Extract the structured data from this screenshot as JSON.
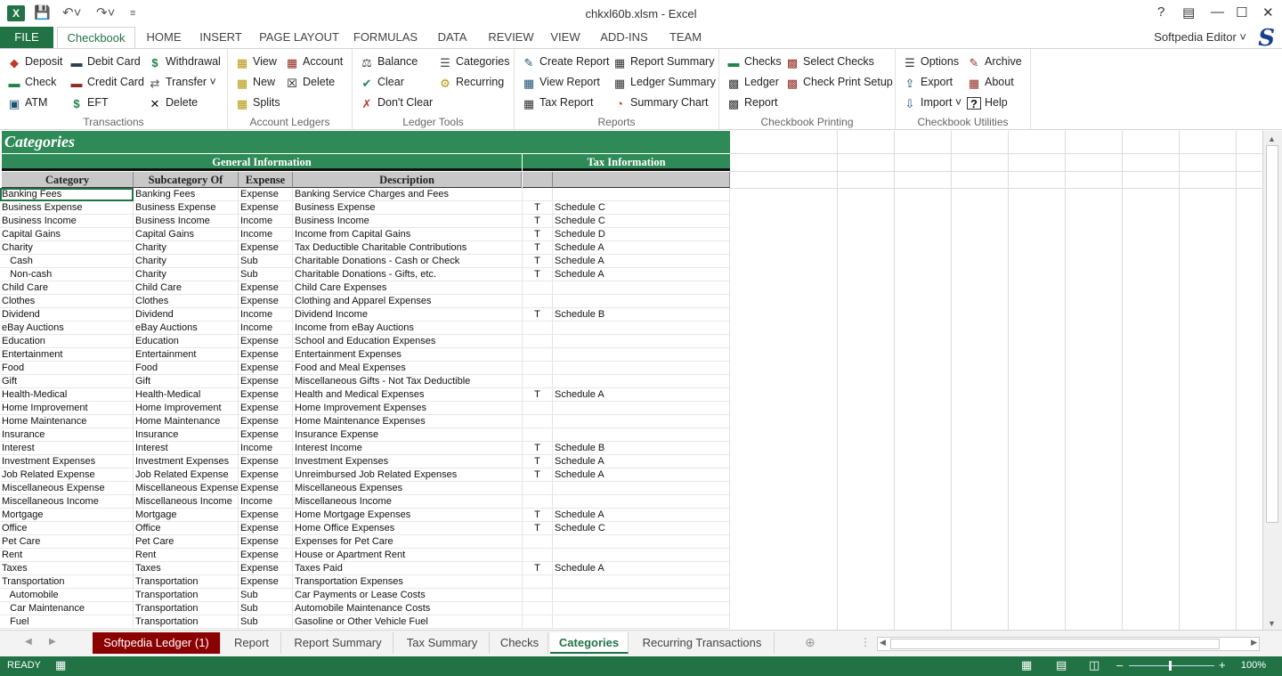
{
  "window": {
    "title": "chkxl60b.xlsm - Excel",
    "user": "Softpedia Editor",
    "user_logo": "S",
    "app_logo": "X"
  },
  "tabs": [
    "FILE",
    "Checkbook",
    "HOME",
    "INSERT",
    "PAGE LAYOUT",
    "FORMULAS",
    "DATA",
    "REVIEW",
    "VIEW",
    "ADD-INS",
    "TEAM"
  ],
  "ribbon": {
    "groups": {
      "transactions": "Transactions",
      "account_ledgers": "Account Ledgers",
      "ledger_tools": "Ledger Tools",
      "reports": "Reports",
      "checkbook_printing": "Checkbook Printing",
      "checkbook_utilities": "Checkbook Utilities"
    },
    "buttons": {
      "deposit": "Deposit",
      "debit_card": "Debit Card",
      "withdrawal": "Withdrawal",
      "check": "Check",
      "credit_card": "Credit Card",
      "transfer": "Transfer",
      "atm": "ATM",
      "eft": "EFT",
      "delete_tx": "Delete",
      "view": "View",
      "account": "Account",
      "new": "New",
      "delete_acct": "Delete",
      "splits": "Splits",
      "balance": "Balance",
      "categories": "Categories",
      "clear": "Clear",
      "recurring": "Recurring",
      "dont_clear": "Don't Clear",
      "create_report": "Create Report",
      "report_summary": "Report Summary",
      "view_report": "View Report",
      "ledger_summary": "Ledger Summary",
      "tax_report": "Tax Report",
      "summary_chart": "Summary Chart",
      "checks": "Checks",
      "select_checks": "Select Checks",
      "ledger": "Ledger",
      "check_print_setup": "Check Print Setup",
      "report": "Report",
      "options": "Options",
      "archive": "Archive",
      "export": "Export",
      "about": "About",
      "import": "Import",
      "help": "Help"
    }
  },
  "sheet": {
    "title": "Categories",
    "band_general": "General Information",
    "band_tax": "Tax Information",
    "headers": [
      "Category",
      "Subcategory Of",
      "Expense",
      "Description",
      "",
      ""
    ],
    "rows": [
      [
        "Banking Fees",
        "Banking Fees",
        "Expense",
        "Banking Service Charges and Fees",
        "",
        ""
      ],
      [
        "Business Expense",
        "Business Expense",
        "Expense",
        "Business Expense",
        "T",
        "Schedule C"
      ],
      [
        "Business Income",
        "Business Income",
        "Income",
        "Business Income",
        "T",
        "Schedule C"
      ],
      [
        "Capital Gains",
        "Capital Gains",
        "Income",
        "Income from Capital Gains",
        "T",
        "Schedule D"
      ],
      [
        "Charity",
        "Charity",
        "Expense",
        "Tax Deductible Charitable Contributions",
        "T",
        "Schedule A"
      ],
      [
        "   Cash",
        "Charity",
        "Sub",
        "Charitable Donations - Cash or Check",
        "T",
        "Schedule A"
      ],
      [
        "   Non-cash",
        "Charity",
        "Sub",
        "Charitable Donations - Gifts, etc.",
        "T",
        "Schedule A"
      ],
      [
        "Child Care",
        "Child Care",
        "Expense",
        "Child Care Expenses",
        "",
        ""
      ],
      [
        "Clothes",
        "Clothes",
        "Expense",
        "Clothing and Apparel Expenses",
        "",
        ""
      ],
      [
        "Dividend",
        "Dividend",
        "Income",
        "Dividend Income",
        "T",
        "Schedule B"
      ],
      [
        "eBay Auctions",
        "eBay Auctions",
        "Income",
        "Income from eBay Auctions",
        "",
        ""
      ],
      [
        "Education",
        "Education",
        "Expense",
        "School and Education Expenses",
        "",
        ""
      ],
      [
        "Entertainment",
        "Entertainment",
        "Expense",
        "Entertainment Expenses",
        "",
        ""
      ],
      [
        "Food",
        "Food",
        "Expense",
        "Food and Meal Expenses",
        "",
        ""
      ],
      [
        "Gift",
        "Gift",
        "Expense",
        "Miscellaneous Gifts - Not Tax Deductible",
        "",
        ""
      ],
      [
        "Health-Medical",
        "Health-Medical",
        "Expense",
        "Health and Medical Expenses",
        "T",
        "Schedule A"
      ],
      [
        "Home Improvement",
        "Home Improvement",
        "Expense",
        "Home Improvement Expenses",
        "",
        ""
      ],
      [
        "Home Maintenance",
        "Home Maintenance",
        "Expense",
        "Home Maintenance Expenses",
        "",
        ""
      ],
      [
        "Insurance",
        "Insurance",
        "Expense",
        "Insurance Expense",
        "",
        ""
      ],
      [
        "Interest",
        "Interest",
        "Income",
        "Interest Income",
        "T",
        "Schedule B"
      ],
      [
        "Investment Expenses",
        "Investment Expenses",
        "Expense",
        "Investment Expenses",
        "T",
        "Schedule A"
      ],
      [
        "Job Related Expense",
        "Job Related Expense",
        "Expense",
        "Unreimbursed Job Related Expenses",
        "T",
        "Schedule A"
      ],
      [
        "Miscellaneous Expense",
        "Miscellaneous Expense",
        "Expense",
        "Miscellaneous Expenses",
        "",
        ""
      ],
      [
        "Miscellaneous Income",
        "Miscellaneous Income",
        "Income",
        "Miscellaneous Income",
        "",
        ""
      ],
      [
        "Mortgage",
        "Mortgage",
        "Expense",
        "Home Mortgage Expenses",
        "T",
        "Schedule A"
      ],
      [
        "Office",
        "Office",
        "Expense",
        "Home Office Expenses",
        "T",
        "Schedule C"
      ],
      [
        "Pet Care",
        "Pet Care",
        "Expense",
        "Expenses for Pet Care",
        "",
        ""
      ],
      [
        "Rent",
        "Rent",
        "Expense",
        "House or Apartment Rent",
        "",
        ""
      ],
      [
        "Taxes",
        "Taxes",
        "Expense",
        "Taxes Paid",
        "T",
        "Schedule A"
      ],
      [
        "Transportation",
        "Transportation",
        "Expense",
        "Transportation Expenses",
        "",
        ""
      ],
      [
        "   Automobile",
        "Transportation",
        "Sub",
        "Car Payments or Lease Costs",
        "",
        ""
      ],
      [
        "   Car Maintenance",
        "Transportation",
        "Sub",
        "Automobile Maintenance Costs",
        "",
        ""
      ],
      [
        "   Fuel",
        "Transportation",
        "Sub",
        "Gasoline or Other Vehicle Fuel",
        "",
        ""
      ]
    ]
  },
  "sheet_tabs": [
    "Softpedia Ledger (1)",
    "Report",
    "Report Summary",
    "Tax Summary",
    "Checks",
    "Categories",
    "Recurring Transactions"
  ],
  "status": {
    "ready": "READY",
    "zoom": "100%"
  }
}
